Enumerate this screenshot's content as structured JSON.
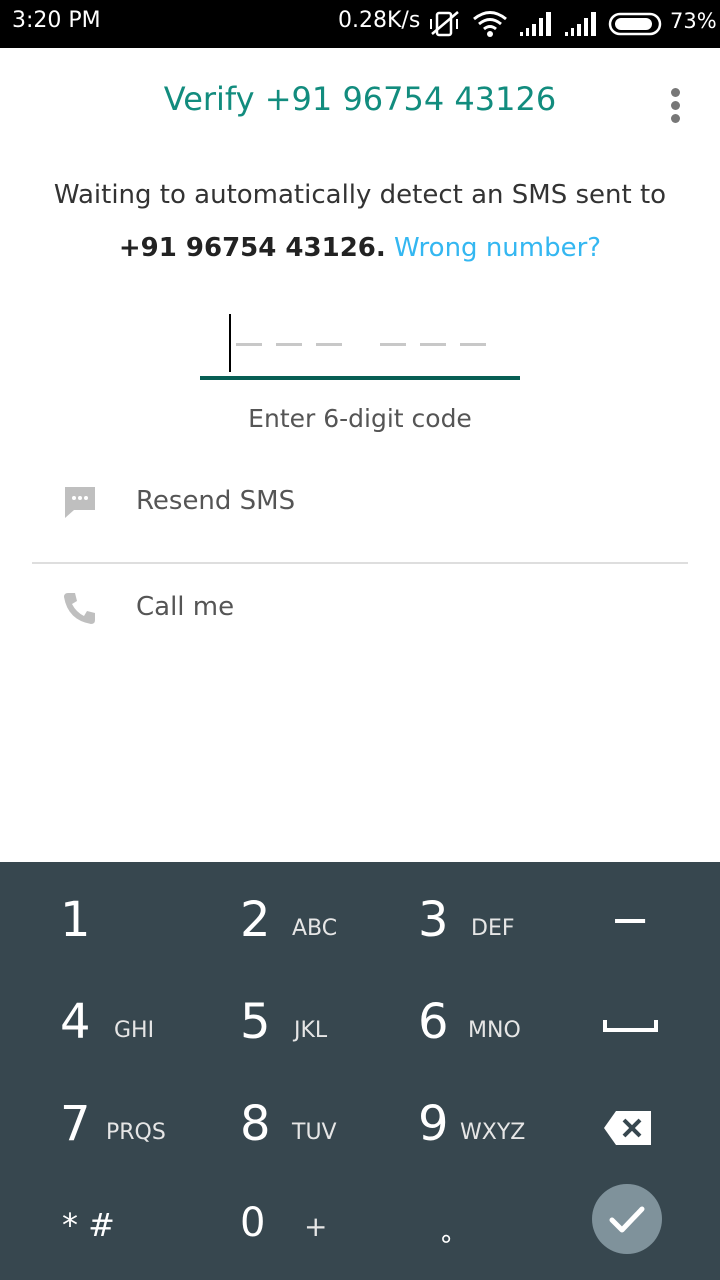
{
  "status_bar": {
    "time": "3:20 PM",
    "speed": "0.28K/s",
    "battery": "73%",
    "icons": [
      "vibrate-off-icon",
      "wifi-icon",
      "signal-icon",
      "signal-icon",
      "battery-icon"
    ]
  },
  "header": {
    "title": "Verify +91 96754 43126",
    "menu_icon": "more-vert-icon"
  },
  "description": {
    "line1": "Waiting to automatically detect an SMS sent to",
    "number": "+91 96754 43126.",
    "wrong_number_link": "Wrong number?"
  },
  "code_input": {
    "value": "",
    "hint": "Enter 6-digit code",
    "digits": 6
  },
  "options": [
    {
      "label": "Resend SMS",
      "icon": "message-icon"
    },
    {
      "label": "Call me",
      "icon": "phone-icon"
    }
  ],
  "keypad": {
    "keys": [
      {
        "digit": "1",
        "letters": ""
      },
      {
        "digit": "2",
        "letters": "ABC"
      },
      {
        "digit": "3",
        "letters": "DEF"
      },
      {
        "digit": "−",
        "letters": ""
      },
      {
        "digit": "4",
        "letters": "GHI"
      },
      {
        "digit": "5",
        "letters": "JKL"
      },
      {
        "digit": "6",
        "letters": "MNO"
      },
      {
        "digit": "",
        "letters": ""
      },
      {
        "digit": "7",
        "letters": "PRQS"
      },
      {
        "digit": "8",
        "letters": "TUV"
      },
      {
        "digit": "9",
        "letters": "WXYZ"
      },
      {
        "digit": "",
        "letters": ""
      },
      {
        "digit": "* #",
        "letters": ""
      },
      {
        "digit": "0",
        "letters": "+"
      },
      {
        "digit": "∘",
        "letters": ""
      }
    ],
    "space_icon": "space-icon",
    "backspace_icon": "backspace-icon",
    "done_icon": "check-icon",
    "colors": {
      "background": "#37474f",
      "fab": "#7f929b"
    }
  },
  "colors": {
    "accent": "#128c7e",
    "link": "#34b7f1",
    "underline": "#075e54"
  }
}
